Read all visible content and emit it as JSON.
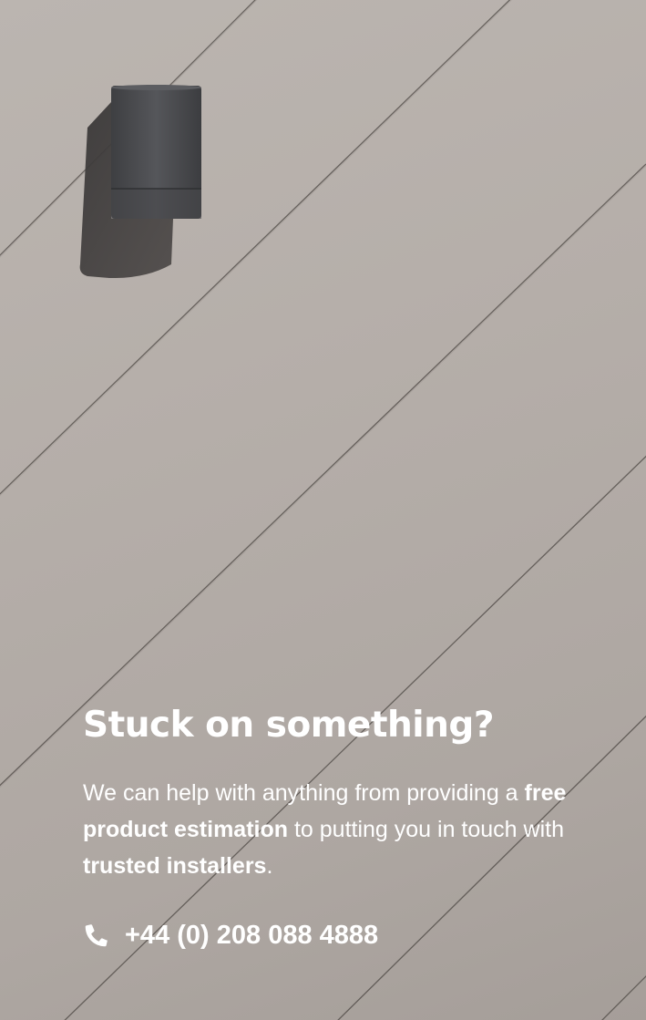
{
  "banner": {
    "headline": "Stuck on something?",
    "body": {
      "part1": "We can help with anything from providing a ",
      "emphasis1": "free product estimation",
      "part2": " to putting you in touch with ",
      "emphasis2": "trusted installers",
      "part3": "."
    },
    "phone": {
      "icon": "phone-icon",
      "number": "+44 (0) 208 088 4888"
    }
  },
  "colors": {
    "text": "#ffffff",
    "wall": "#b3aca7",
    "lamp": "#4a4b4d"
  }
}
